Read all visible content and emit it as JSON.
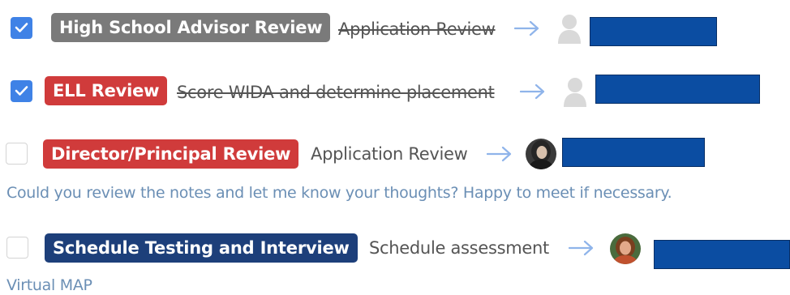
{
  "tasks": [
    {
      "checked": true,
      "badge": "High School Advisor Review",
      "badge_color": "#7a7a7a",
      "description": "Application Review",
      "completed": true,
      "assignee_avatar": "placeholder-avatar-icon",
      "note": ""
    },
    {
      "checked": true,
      "badge": "ELL Review",
      "badge_color": "#d03b3b",
      "description": "Score WIDA and determine placement",
      "completed": true,
      "assignee_avatar": "placeholder-avatar-icon",
      "note": ""
    },
    {
      "checked": false,
      "badge": "Director/Principal Review",
      "badge_color": "#d03b3b",
      "description": "Application Review",
      "completed": false,
      "assignee_avatar": "user-photo-avatar",
      "note": "Could you review the notes and let me know your thoughts? Happy to meet if necessary."
    },
    {
      "checked": false,
      "badge": "Schedule Testing and Interview",
      "badge_color": "#1d3f7a",
      "description": "Schedule assessment",
      "completed": false,
      "assignee_avatar": "user-photo-avatar",
      "note": "Virtual MAP"
    }
  ],
  "colors": {
    "checkbox_checked": "#3f82e6",
    "arrow": "#8fb4ea",
    "note_text": "#6b8fb5",
    "redaction": "#0b4da2"
  },
  "icons": {
    "arrow": "arrow-right-icon",
    "check": "checkmark-icon"
  }
}
